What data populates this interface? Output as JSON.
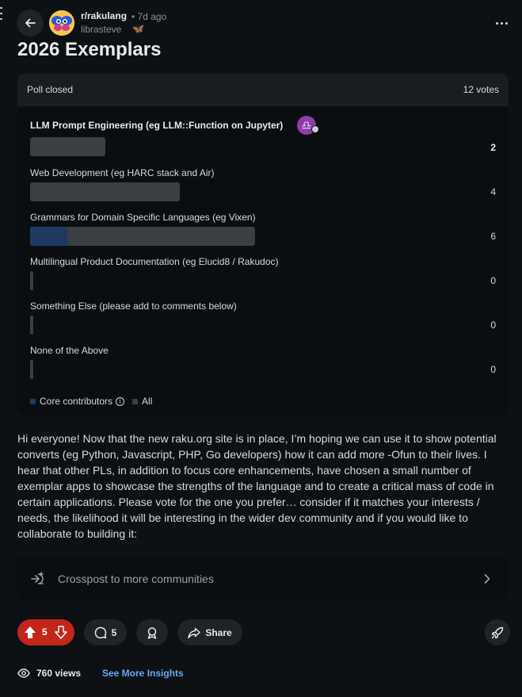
{
  "header": {
    "subreddit": "r/rakulang",
    "time": "• 7d ago",
    "author": "librasteve",
    "author_flair": "🦋"
  },
  "post": {
    "title": "2026 Exemplars",
    "body": "Hi everyone! Now that the new raku.org site is in place, I’m hoping we can use it to show potential converts (eg Python, Javascript, PHP, Go developers) how it can add more -Ofun to their lives. I hear that other PLs, in addition to focus core enhancements, have chosen a small number of exemplar apps to showcase the strengths of the language and to create a critical mass of code in certain applications. Please vote for the one you prefer… consider if it matches your interests / needs, the likelihood it will be interesting in the wider dev community and if you would like to collaborate to building it:"
  },
  "poll": {
    "status": "Poll closed",
    "total_votes": "12 votes",
    "max_votes": 6,
    "options": [
      {
        "label": "LLM Prompt Engineering (eg LLM::Function on Jupyter)",
        "count": "2",
        "votes": 2,
        "core_votes": 0,
        "winner": true
      },
      {
        "label": "Web Development (eg HARC stack and Air)",
        "count": "4",
        "votes": 4,
        "core_votes": 0,
        "winner": false
      },
      {
        "label": "Grammars for Domain Specific Languages (eg Vixen)",
        "count": "6",
        "votes": 6,
        "core_votes": 1,
        "winner": false
      },
      {
        "label": "Multilingual Product Documentation (eg Elucid8 / Rakudoc)",
        "count": "0",
        "votes": 0,
        "core_votes": 0,
        "winner": false
      },
      {
        "label": "Something Else (please add to comments below)",
        "count": "0",
        "votes": 0,
        "core_votes": 0,
        "winner": false
      },
      {
        "label": "None of the Above",
        "count": "0",
        "votes": 0,
        "core_votes": 0,
        "winner": false
      }
    ],
    "legend": {
      "core_label": "Core contributors",
      "all_label": "All",
      "core_color": "#1e3a63",
      "all_color": "#3a3f43"
    },
    "flair_icon": "libra-sign-icon"
  },
  "crosspost": {
    "label": "Crosspost to more communities"
  },
  "actions": {
    "score": "5",
    "comments": "5",
    "share_label": "Share",
    "upvote_color": "#c2261a"
  },
  "stats": {
    "views": "760 views",
    "insights_label": "See More Insights"
  }
}
